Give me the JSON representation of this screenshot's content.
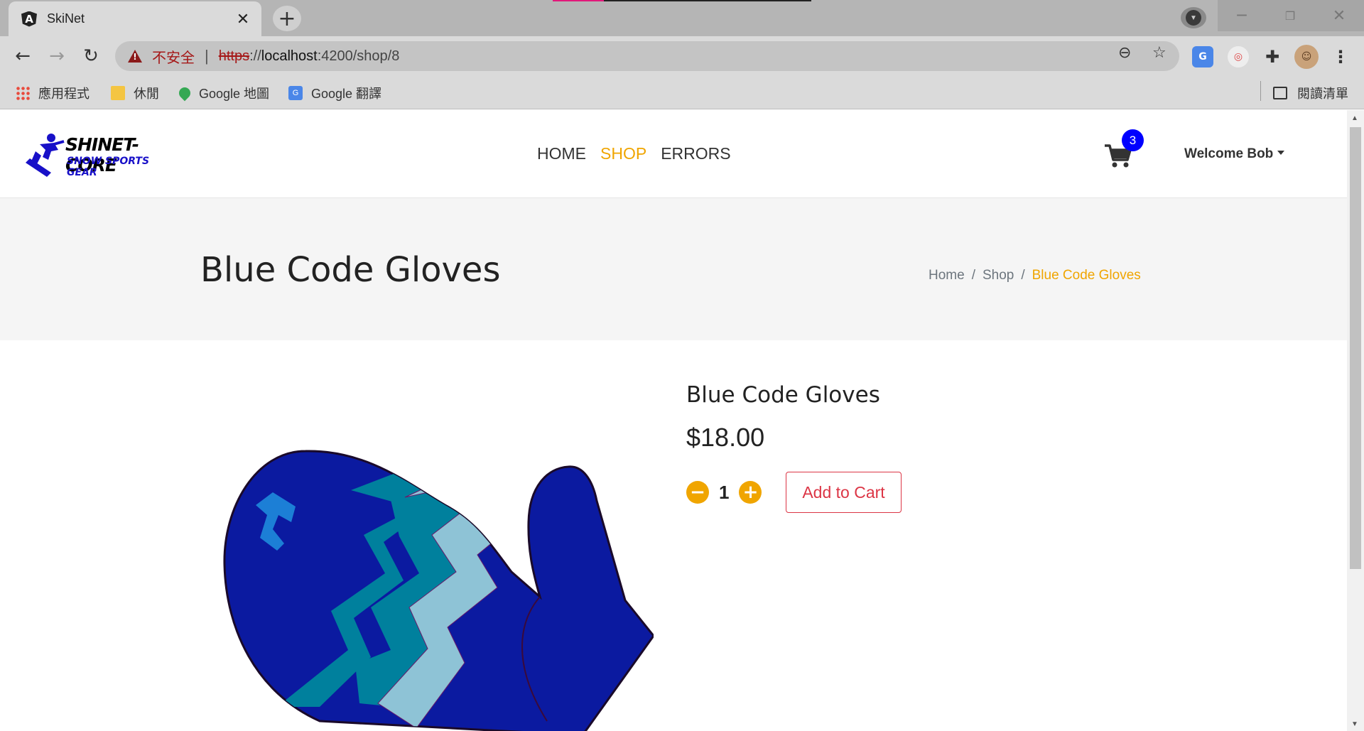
{
  "browser": {
    "tab_title": "SkiNet",
    "tab_close": "✕",
    "new_tab": "+",
    "security_label": "不安全",
    "url_scheme": "https",
    "url_sep": "://",
    "url_host": "localhost",
    "url_rest": ":4200/shop/8",
    "bookmarks": [
      {
        "label": "應用程式",
        "icon": "apps-grid-icon"
      },
      {
        "label": "休閒",
        "icon": "folder-icon"
      },
      {
        "label": "Google 地圖",
        "icon": "maps-pin-icon"
      },
      {
        "label": "Google 翻譯",
        "icon": "translate-icon"
      }
    ],
    "reading_list": "閱讀清單"
  },
  "site": {
    "logo_line1": "SHINET-CORE",
    "logo_line2": "SNOW SPORTS GEAR",
    "nav": [
      {
        "label": "HOME"
      },
      {
        "label": "SHOP",
        "active": true
      },
      {
        "label": "ERRORS"
      }
    ],
    "cart_count": "3",
    "welcome": "Welcome Bob"
  },
  "section_header": {
    "title": "Blue Code Gloves",
    "breadcrumb": [
      "Home",
      "Shop",
      "Blue Code Gloves"
    ],
    "breadcrumb_separator": "/"
  },
  "product": {
    "name": "Blue Code Gloves",
    "price": "$18.00",
    "quantity": "1",
    "decrement": "−",
    "increment": "+",
    "add_to_cart": "Add to Cart"
  },
  "colors": {
    "accent": "#f0a500",
    "danger": "#dc3545",
    "badge": "#0000ff",
    "glove_dark": "#0b1aa0",
    "glove_teal": "#00809d",
    "glove_light": "#8ec3d6"
  }
}
